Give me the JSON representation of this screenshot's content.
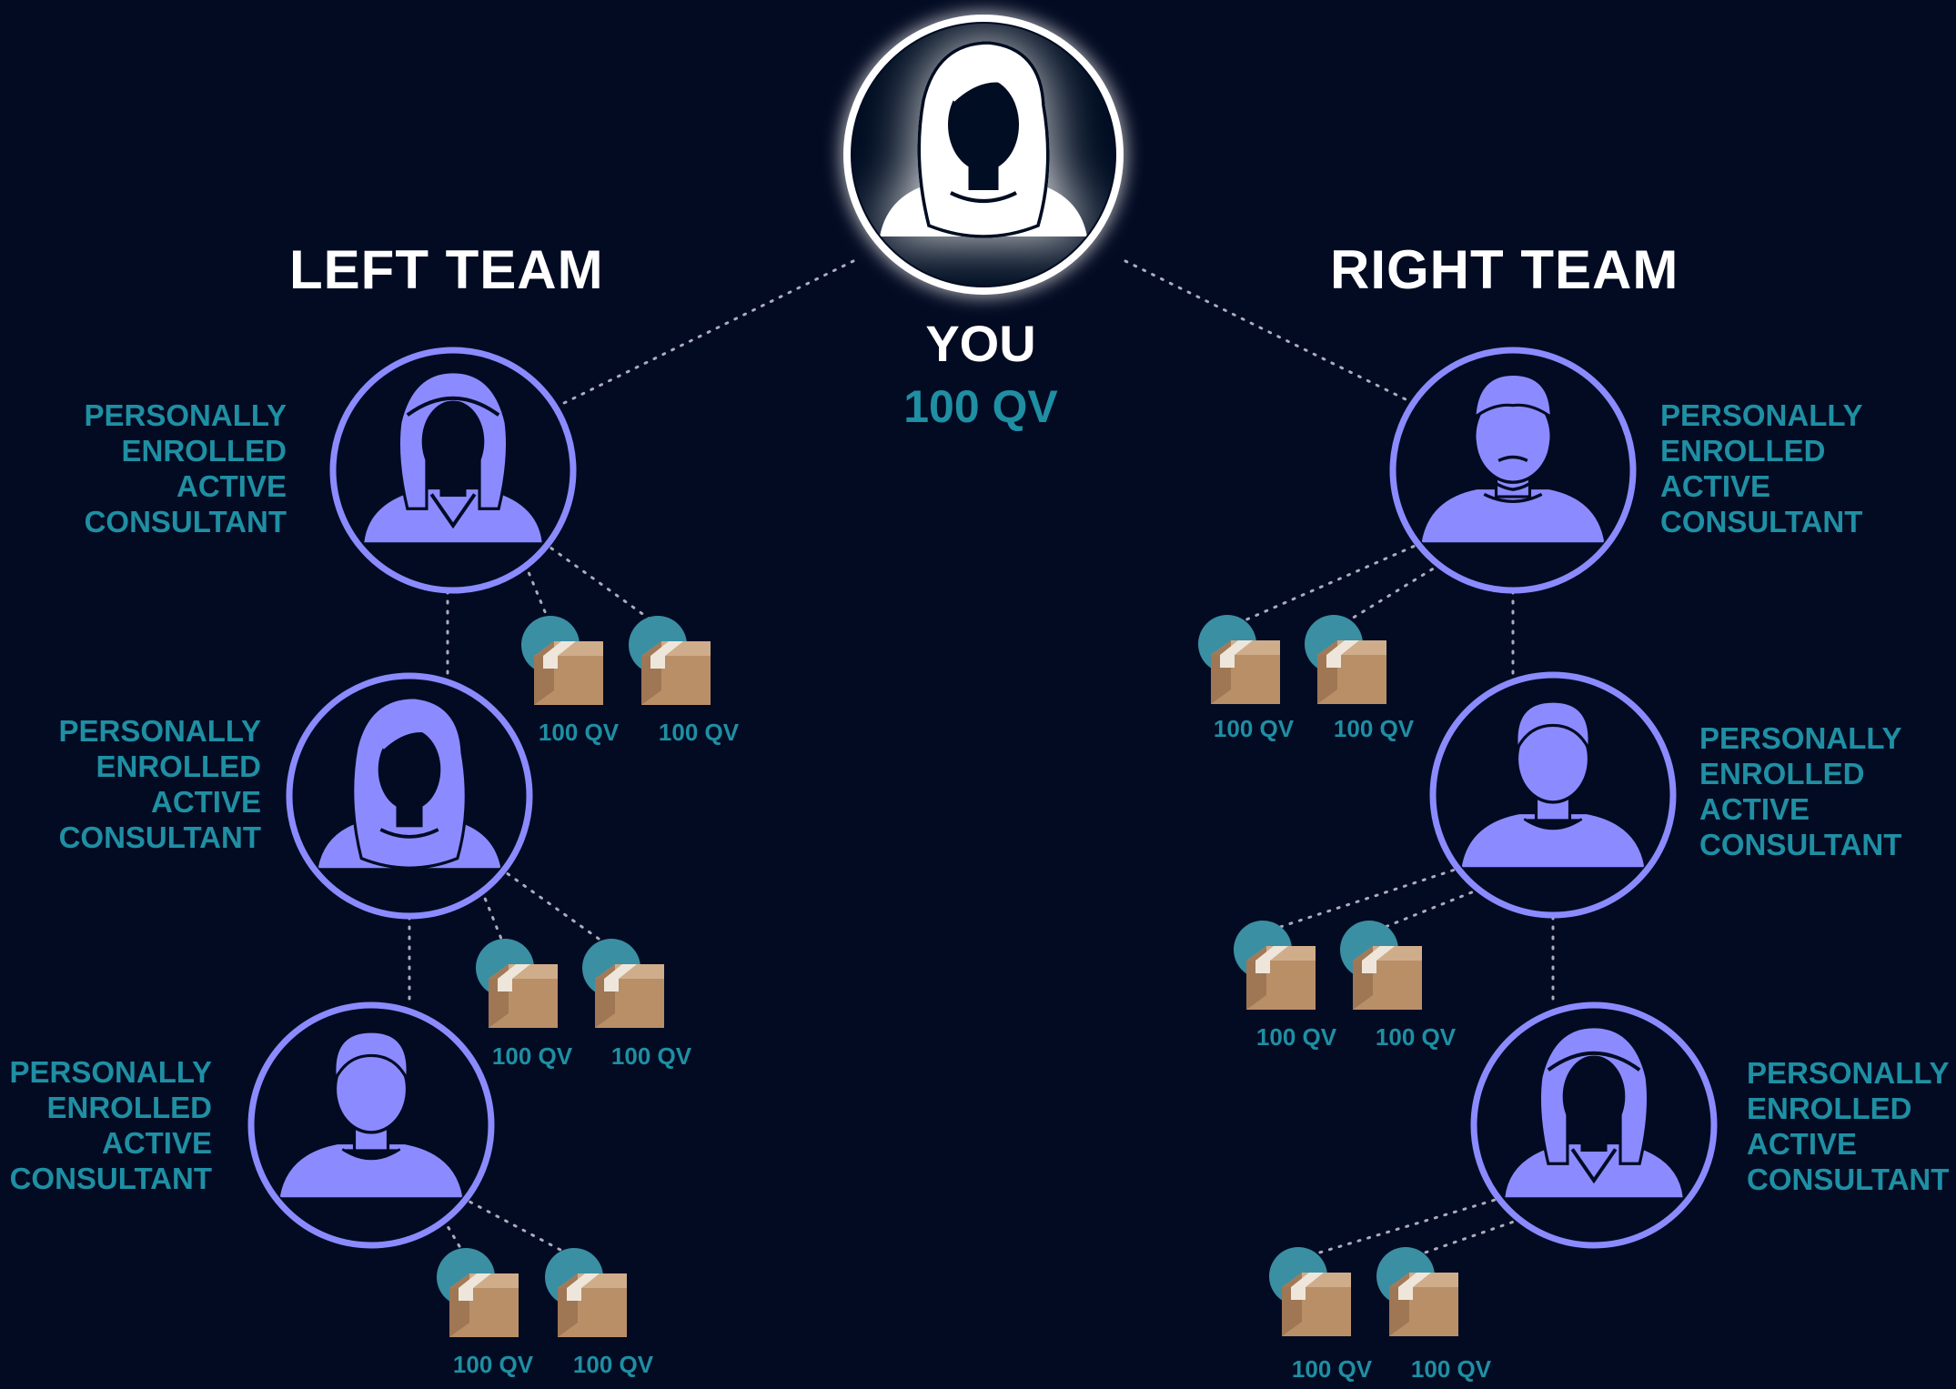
{
  "top": {
    "title": "YOU",
    "qv": "100 QV"
  },
  "left_team": {
    "title": "LEFT TEAM",
    "members": [
      {
        "avatar": "woman-headband-icon",
        "role": [
          "PERSONALLY",
          "ENROLLED",
          "ACTIVE",
          "CONSULTANT"
        ],
        "orders": [
          "100 QV",
          "100 QV"
        ]
      },
      {
        "avatar": "woman-long-hair-icon",
        "role": [
          "PERSONALLY",
          "ENROLLED",
          "ACTIVE",
          "CONSULTANT"
        ],
        "orders": [
          "100 QV",
          "100 QV"
        ]
      },
      {
        "avatar": "man-short-hair-icon",
        "role": [
          "PERSONALLY",
          "ENROLLED",
          "ACTIVE",
          "CONSULTANT"
        ],
        "orders": [
          "100 QV",
          "100 QV"
        ]
      }
    ]
  },
  "right_team": {
    "title": "RIGHT TEAM",
    "members": [
      {
        "avatar": "man-beard-icon",
        "role": [
          "PERSONALLY",
          "ENROLLED",
          "ACTIVE",
          "CONSULTANT"
        ],
        "orders": [
          "100 QV",
          "100 QV"
        ]
      },
      {
        "avatar": "man-short-hair-icon",
        "role": [
          "PERSONALLY",
          "ENROLLED",
          "ACTIVE",
          "CONSULTANT"
        ],
        "orders": [
          "100 QV",
          "100 QV"
        ]
      },
      {
        "avatar": "woman-headband-icon",
        "role": [
          "PERSONALLY",
          "ENROLLED",
          "ACTIVE",
          "CONSULTANT"
        ],
        "orders": [
          "100 QV",
          "100 QV"
        ]
      }
    ]
  },
  "colors": {
    "background": "#030b23",
    "avatar": "#8b8bff",
    "accent_teal": "#1f8fa3",
    "teal_dot": "#3a8fa3",
    "box": "#b58f6c",
    "connector": "#c9c9d6"
  }
}
